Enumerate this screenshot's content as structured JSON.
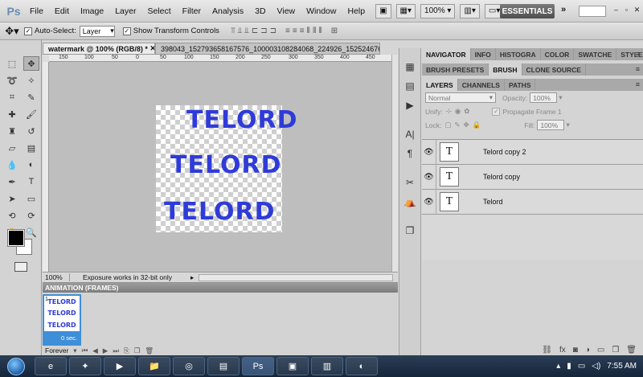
{
  "menubar": {
    "logo": "Ps",
    "items": [
      "File",
      "Edit",
      "Image",
      "Layer",
      "Select",
      "Filter",
      "Analysis",
      "3D",
      "View",
      "Window",
      "Help"
    ],
    "zoom": "100%",
    "workspace": "ESSENTIALS"
  },
  "options": {
    "auto_select_label": "Auto-Select:",
    "auto_select_value": "Layer",
    "show_transform_label": "Show Transform Controls"
  },
  "document": {
    "tabs": [
      "watermark @ 100% (RGB/8) *",
      "398043_152793658167576_100003108284068_224926_1525246768_"
    ],
    "ruler_ticks": [
      "150",
      "100",
      "50",
      "0",
      "50",
      "100",
      "150",
      "200",
      "250",
      "300",
      "350",
      "400",
      "450"
    ],
    "texts": [
      "TELORD",
      "TELORD",
      "TELORD"
    ]
  },
  "status": {
    "zoom": "100%",
    "info": "Exposure works in 32-bit only"
  },
  "animation": {
    "title": "ANIMATION (FRAMES)",
    "frame_number": "1",
    "frame_delay": "0 sec.",
    "loop": "Forever"
  },
  "panels": {
    "top_tabs": [
      "NAVIGATOR",
      "INFO",
      "HISTOGRA",
      "COLOR",
      "SWATCHE",
      "STYLES"
    ],
    "brush_tabs": [
      "BRUSH PRESETS",
      "BRUSH",
      "CLONE SOURCE"
    ],
    "layer_tabs": [
      "LAYERS",
      "CHANNELS",
      "PATHS"
    ],
    "blend_mode": "Normal",
    "opacity_label": "Opacity:",
    "opacity_value": "100%",
    "unify_label": "Unify:",
    "propagate_label": "Propagate Frame 1",
    "lock_label": "Lock:",
    "fill_label": "Fill:",
    "fill_value": "100%",
    "layers": [
      {
        "name": "Telord copy 2",
        "thumb": "T"
      },
      {
        "name": "Telord copy",
        "thumb": "T"
      },
      {
        "name": "Telord",
        "thumb": "T"
      }
    ]
  },
  "taskbar": {
    "time": "7:55 AM"
  }
}
